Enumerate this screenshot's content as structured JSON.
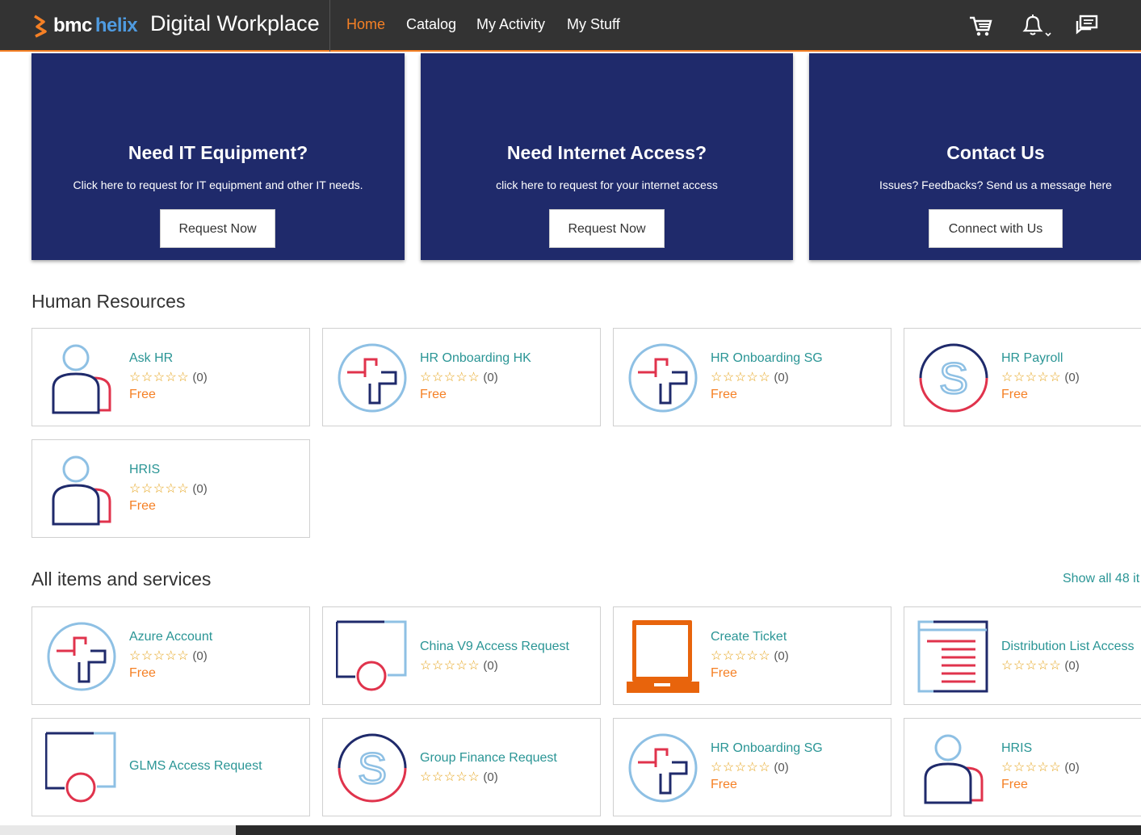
{
  "header": {
    "logo_bmc": "bmc",
    "logo_helix": "helix",
    "app_title": "Digital Workplace",
    "nav": [
      "Home",
      "Catalog",
      "My Activity",
      "My Stuff"
    ],
    "active_nav": "Home",
    "icons": [
      "cart-icon",
      "bell-icon",
      "chat-icon"
    ]
  },
  "promos": [
    {
      "title": "Need IT Equipment?",
      "text": "Click here to request for IT equipment and other IT needs.",
      "button": "Request Now"
    },
    {
      "title": "Need Internet Access?",
      "text": "click here to request for your internet access",
      "button": "Request Now"
    },
    {
      "title": "Contact Us",
      "text": "Issues? Feedbacks? Send us a message here",
      "button": "Connect with Us"
    }
  ],
  "hr_section": {
    "title": "Human Resources",
    "items": [
      {
        "name": "Ask HR",
        "stars": "☆☆☆☆☆",
        "count": "(0)",
        "price": "Free",
        "icon": "person-icon"
      },
      {
        "name": "HR Onboarding HK",
        "stars": "☆☆☆☆☆",
        "count": "(0)",
        "price": "Free",
        "icon": "plus-circle-icon"
      },
      {
        "name": "HR Onboarding SG",
        "stars": "☆☆☆☆☆",
        "count": "(0)",
        "price": "Free",
        "icon": "plus-circle-icon"
      },
      {
        "name": "HR Payroll",
        "stars": "☆☆☆☆☆",
        "count": "(0)",
        "price": "Free",
        "icon": "s-circle-icon"
      },
      {
        "name": "HRIS",
        "stars": "☆☆☆☆☆",
        "count": "(0)",
        "price": "Free",
        "icon": "person-icon"
      }
    ]
  },
  "all_section": {
    "title": "All items and services",
    "show_all": "Show all 48 it",
    "items": [
      {
        "name": "Azure Account",
        "stars": "☆☆☆☆☆",
        "count": "(0)",
        "price": "Free",
        "icon": "plus-circle-icon"
      },
      {
        "name": "China V9 Access Request",
        "stars": "☆☆☆☆☆",
        "count": "(0)",
        "icon": "window-circle-icon"
      },
      {
        "name": "Create Ticket",
        "stars": "☆☆☆☆☆",
        "count": "(0)",
        "price": "Free",
        "icon": "laptop-icon"
      },
      {
        "name": "Distribution List Access",
        "stars": "☆☆☆☆☆",
        "count": "(0)",
        "icon": "document-list-icon"
      },
      {
        "name": "GLMS Access Request",
        "icon": "window-circle-icon"
      },
      {
        "name": "Group Finance Request",
        "stars": "☆☆☆☆☆",
        "count": "(0)",
        "icon": "s-circle-icon"
      },
      {
        "name": "HR Onboarding SG",
        "stars": "☆☆☆☆☆",
        "count": "(0)",
        "price": "Free",
        "icon": "plus-circle-icon"
      },
      {
        "name": "HRIS",
        "stars": "☆☆☆☆☆",
        "count": "(0)",
        "price": "Free",
        "icon": "person-icon"
      }
    ]
  },
  "colors": {
    "accent": "#f58025",
    "banner": "#1f2a6b",
    "link": "#2a9595",
    "header": "#333333"
  }
}
